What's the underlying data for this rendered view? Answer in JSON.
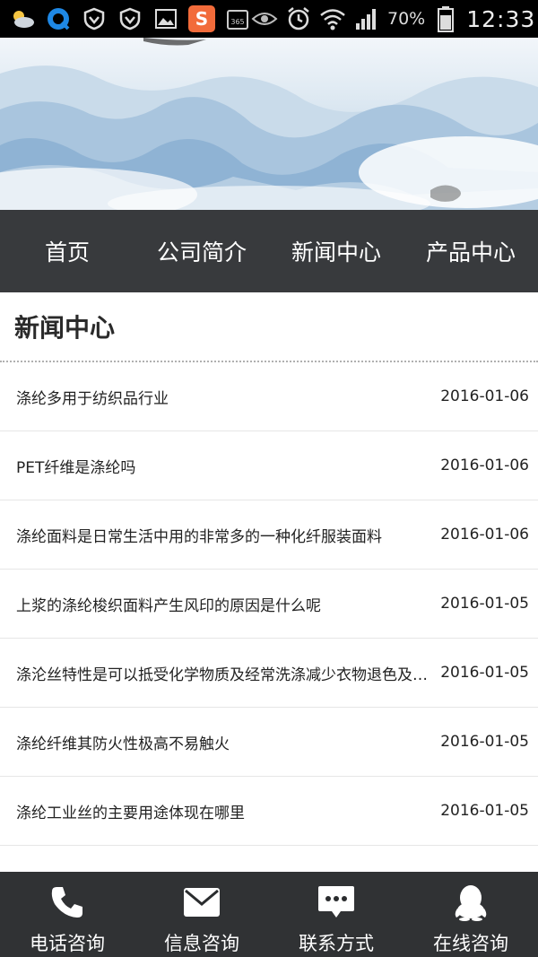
{
  "status_bar": {
    "battery_percent": "70%",
    "time": "12:33",
    "icons": [
      "weather-icon",
      "browser-icon",
      "vpn-shield-icon",
      "vpn-shield-icon",
      "gallery-icon",
      "sogou-icon",
      "calendar-365-icon",
      "eye-icon",
      "alarm-icon",
      "wifi-icon",
      "signal-icon",
      "battery-icon"
    ],
    "calendar_label": "365",
    "sogou_label": "S"
  },
  "nav": {
    "items": [
      {
        "label": "首页"
      },
      {
        "label": "公司简介"
      },
      {
        "label": "新闻中心"
      },
      {
        "label": "产品中心"
      }
    ]
  },
  "section": {
    "title": "新闻中心"
  },
  "news": [
    {
      "title": "涤纶多用于纺织品行业",
      "date": "2016-01-06"
    },
    {
      "title": "PET纤维是涤纶吗",
      "date": "2016-01-06"
    },
    {
      "title": "涤纶面料是日常生活中用的非常多的一种化纤服装面料",
      "date": "2016-01-06"
    },
    {
      "title": "上浆的涤纶梭织面料产生风印的原因是什么呢",
      "date": "2016-01-05"
    },
    {
      "title": "涤沦丝特性是可以抵受化学物质及经常洗涤减少衣物退色及…",
      "date": "2016-01-05"
    },
    {
      "title": "涤纶纤维其防火性极高不易触火",
      "date": "2016-01-05"
    },
    {
      "title": "涤纶工业丝的主要用途体现在哪里",
      "date": "2016-01-05"
    }
  ],
  "bottom_bar": {
    "items": [
      {
        "label": "电话咨询",
        "icon": "phone-icon"
      },
      {
        "label": "信息咨询",
        "icon": "envelope-icon"
      },
      {
        "label": "联系方式",
        "icon": "chat-bubble-icon"
      },
      {
        "label": "在线咨询",
        "icon": "qq-penguin-icon"
      }
    ]
  },
  "colors": {
    "nav_bg": "#383a3d",
    "bottom_bar_bg": "#282a2c",
    "text": "#222222"
  }
}
